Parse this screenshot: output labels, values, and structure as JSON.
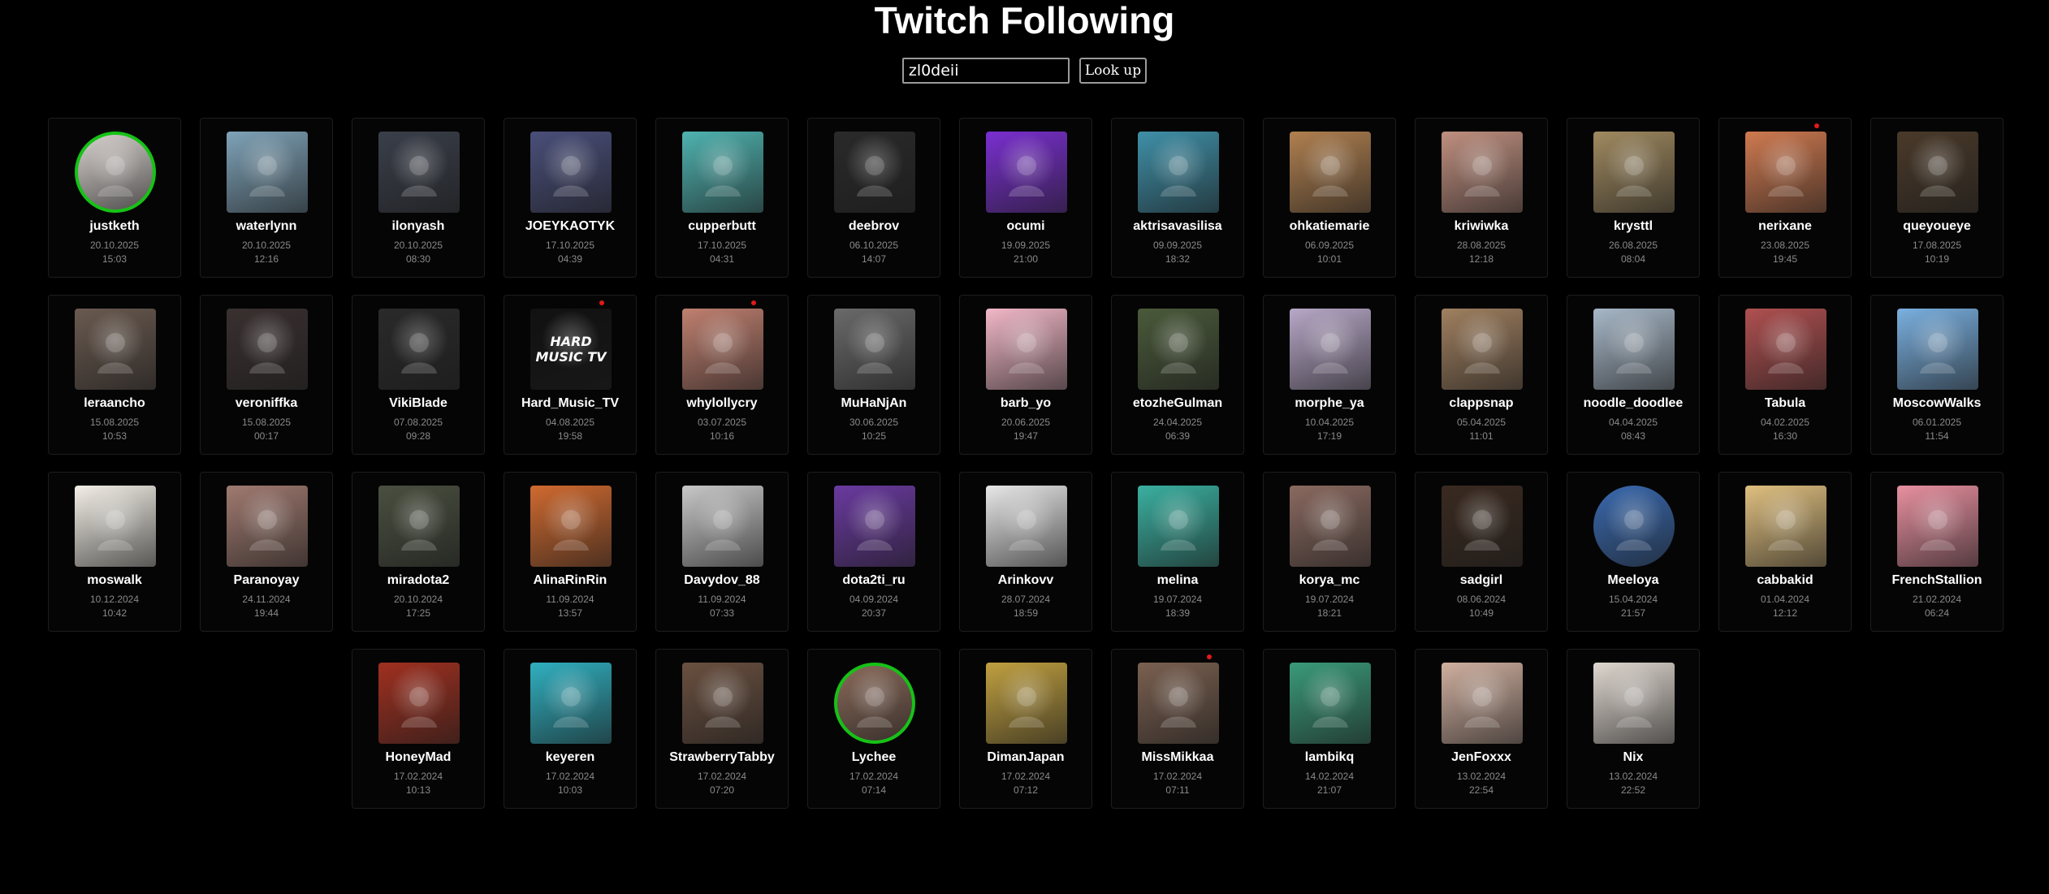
{
  "page": {
    "title": "Twitch Following",
    "search": {
      "value": "zl0deii",
      "button_label": "Look up"
    }
  },
  "colors": {
    "background": "#000000",
    "live_ring": "#16c216",
    "notification_dot": "#e01a1a"
  },
  "channels": [
    {
      "name": "justketh",
      "date": "20.10.2025",
      "time": "15:03",
      "live": true,
      "dot": false,
      "color": "#d8d2cf"
    },
    {
      "name": "waterlynn",
      "date": "20.10.2025",
      "time": "12:16",
      "live": false,
      "dot": false,
      "color": "#7fa3b8"
    },
    {
      "name": "ilonyash",
      "date": "20.10.2025",
      "time": "08:30",
      "live": false,
      "dot": false,
      "color": "#3a3f4a"
    },
    {
      "name": "JOEYKAOTYK",
      "date": "17.10.2025",
      "time": "04:39",
      "live": false,
      "dot": false,
      "color": "#4a4f7a"
    },
    {
      "name": "cupperbutt",
      "date": "17.10.2025",
      "time": "04:31",
      "live": false,
      "dot": false,
      "color": "#4fb3b0"
    },
    {
      "name": "deebrov",
      "date": "06.10.2025",
      "time": "14:07",
      "live": false,
      "dot": false,
      "color": "#2a2a2a"
    },
    {
      "name": "ocumi",
      "date": "19.09.2025",
      "time": "21:00",
      "live": false,
      "dot": false,
      "color": "#7a2fd0"
    },
    {
      "name": "aktrisavasilisa",
      "date": "09.09.2025",
      "time": "18:32",
      "live": false,
      "dot": false,
      "color": "#3f90a8"
    },
    {
      "name": "ohkatiemarie",
      "date": "06.09.2025",
      "time": "10:01",
      "live": false,
      "dot": false,
      "color": "#b08050"
    },
    {
      "name": "kriwiwka",
      "date": "28.08.2025",
      "time": "12:18",
      "live": false,
      "dot": false,
      "color": "#c09080"
    },
    {
      "name": "krysttl",
      "date": "26.08.2025",
      "time": "08:04",
      "live": false,
      "dot": false,
      "color": "#a08a60"
    },
    {
      "name": "nerixane",
      "date": "23.08.2025",
      "time": "19:45",
      "live": false,
      "dot": true,
      "color": "#d07a50"
    },
    {
      "name": "queyoueye",
      "date": "17.08.2025",
      "time": "10:19",
      "live": false,
      "dot": false,
      "color": "#4a3a2a"
    },
    {
      "name": "leraancho",
      "date": "15.08.2025",
      "time": "10:53",
      "live": false,
      "dot": false,
      "color": "#6a5a50"
    },
    {
      "name": "veroniffka",
      "date": "15.08.2025",
      "time": "00:17",
      "live": false,
      "dot": false,
      "color": "#3a3030"
    },
    {
      "name": "VikiBlade",
      "date": "07.08.2025",
      "time": "09:28",
      "live": false,
      "dot": false,
      "color": "#2a2a2a"
    },
    {
      "name": "Hard_Music_TV",
      "date": "04.08.2025",
      "time": "19:58",
      "live": false,
      "dot": true,
      "color": "#111111",
      "logo": "HARD MUSIC TV"
    },
    {
      "name": "whylollycry",
      "date": "03.07.2025",
      "time": "10:16",
      "live": false,
      "dot": true,
      "color": "#c08070"
    },
    {
      "name": "MuHaNjAn",
      "date": "30.06.2025",
      "time": "10:25",
      "live": false,
      "dot": false,
      "color": "#6a6a6a"
    },
    {
      "name": "barb_yo",
      "date": "20.06.2025",
      "time": "19:47",
      "live": false,
      "dot": false,
      "color": "#f2b8c8"
    },
    {
      "name": "etozheGulman",
      "date": "24.04.2025",
      "time": "06:39",
      "live": false,
      "dot": false,
      "color": "#4a5a3a"
    },
    {
      "name": "morphe_ya",
      "date": "10.04.2025",
      "time": "17:19",
      "live": false,
      "dot": false,
      "color": "#b8a8c8"
    },
    {
      "name": "clappsnap",
      "date": "05.04.2025",
      "time": "11:01",
      "live": false,
      "dot": false,
      "color": "#a08060"
    },
    {
      "name": "noodle_doodlee",
      "date": "04.04.2025",
      "time": "08:43",
      "live": false,
      "dot": false,
      "color": "#a8b8c8"
    },
    {
      "name": "Tabula",
      "date": "04.02.2025",
      "time": "16:30",
      "live": false,
      "dot": false,
      "color": "#b05050"
    },
    {
      "name": "MoscowWalks",
      "date": "06.01.2025",
      "time": "11:54",
      "live": false,
      "dot": false,
      "color": "#7ab0e0"
    },
    {
      "name": "moswalk",
      "date": "10.12.2024",
      "time": "10:42",
      "live": false,
      "dot": false,
      "color": "#f4f0e8"
    },
    {
      "name": "Paranoyay",
      "date": "24.11.2024",
      "time": "19:44",
      "live": false,
      "dot": false,
      "color": "#a07a70"
    },
    {
      "name": "miradota2",
      "date": "20.10.2024",
      "time": "17:25",
      "live": false,
      "dot": false,
      "color": "#4a5040"
    },
    {
      "name": "AlinaRinRin",
      "date": "11.09.2024",
      "time": "13:57",
      "live": false,
      "dot": false,
      "color": "#d06a30"
    },
    {
      "name": "Davydov_88",
      "date": "11.09.2024",
      "time": "07:33",
      "live": false,
      "dot": false,
      "color": "#c8c8c8"
    },
    {
      "name": "dota2ti_ru",
      "date": "04.09.2024",
      "time": "20:37",
      "live": false,
      "dot": false,
      "color": "#6a3aa0"
    },
    {
      "name": "Arinkovv",
      "date": "28.07.2024",
      "time": "18:59",
      "live": false,
      "dot": false,
      "color": "#e8e8e8"
    },
    {
      "name": "melina",
      "date": "19.07.2024",
      "time": "18:39",
      "live": false,
      "dot": false,
      "color": "#3ab0a0"
    },
    {
      "name": "korya_mc",
      "date": "19.07.2024",
      "time": "18:21",
      "live": false,
      "dot": false,
      "color": "#8a6a60"
    },
    {
      "name": "sadgirl",
      "date": "08.06.2024",
      "time": "10:49",
      "live": false,
      "dot": false,
      "color": "#3a2a20"
    },
    {
      "name": "Meeloya",
      "date": "15.04.2024",
      "time": "21:57",
      "live": false,
      "dot": false,
      "color": "#3a6ab0",
      "circle": true
    },
    {
      "name": "cabbakid",
      "date": "01.04.2024",
      "time": "12:12",
      "live": false,
      "dot": false,
      "color": "#e0c080"
    },
    {
      "name": "FrenchStallion",
      "date": "21.02.2024",
      "time": "06:24",
      "live": false,
      "dot": false,
      "color": "#e890a0"
    },
    {
      "name": "HoneyMad",
      "date": "17.02.2024",
      "time": "10:13",
      "live": false,
      "dot": false,
      "color": "#a03020"
    },
    {
      "name": "keyeren",
      "date": "17.02.2024",
      "time": "10:03",
      "live": false,
      "dot": false,
      "color": "#30b0c0"
    },
    {
      "name": "StrawberryTabby",
      "date": "17.02.2024",
      "time": "07:20",
      "live": false,
      "dot": false,
      "color": "#6a5040"
    },
    {
      "name": "Lychee",
      "date": "17.02.2024",
      "time": "07:14",
      "live": true,
      "dot": false,
      "color": "#8a6a5a"
    },
    {
      "name": "DimanJapan",
      "date": "17.02.2024",
      "time": "07:12",
      "live": false,
      "dot": false,
      "color": "#c0a040"
    },
    {
      "name": "MissMikkaa",
      "date": "17.02.2024",
      "time": "07:11",
      "live": false,
      "dot": true,
      "color": "#7a6050"
    },
    {
      "name": "lambikq",
      "date": "14.02.2024",
      "time": "21:07",
      "live": false,
      "dot": false,
      "color": "#3a9a7a"
    },
    {
      "name": "JenFoxxx",
      "date": "13.02.2024",
      "time": "22:54",
      "live": false,
      "dot": false,
      "color": "#d0b0a0"
    },
    {
      "name": "Nix",
      "date": "13.02.2024",
      "time": "22:52",
      "live": false,
      "dot": false,
      "color": "#e0d8d0"
    }
  ]
}
